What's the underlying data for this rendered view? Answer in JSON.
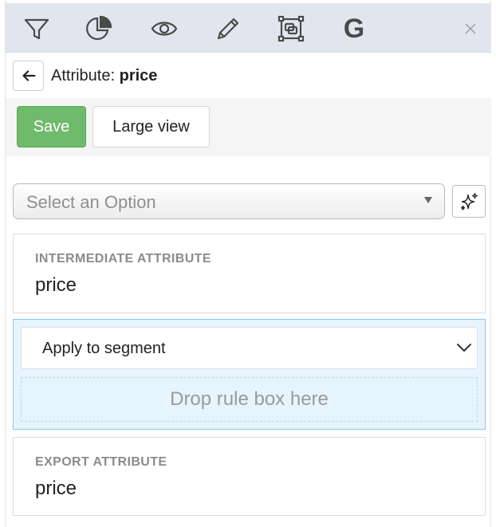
{
  "toolbar": {
    "icons": [
      "filter-icon",
      "pie-chart-icon",
      "eye-icon",
      "pencil-icon",
      "transform-icon",
      "google-icon"
    ],
    "google_letter": "G",
    "close_icon": "close-icon"
  },
  "header": {
    "back_icon": "arrow-left-icon",
    "title_prefix": "Attribute:",
    "title_name": "price"
  },
  "actions": {
    "save_label": "Save",
    "large_view_label": "Large view"
  },
  "option_select": {
    "placeholder": "Select an Option",
    "magic_icon": "sparkles-icon"
  },
  "intermediate": {
    "label": "INTERMEDIATE ATTRIBUTE",
    "value": "price"
  },
  "segment": {
    "select_value": "Apply to segment",
    "drop_text": "Drop rule box here"
  },
  "export": {
    "label": "EXPORT ATTRIBUTE",
    "value": "price"
  },
  "colors": {
    "toolbar_bg": "#e1e6ee",
    "save_green": "#6fbb6c",
    "segment_bg": "#e6f4fd",
    "segment_border": "#8cc6e8"
  }
}
